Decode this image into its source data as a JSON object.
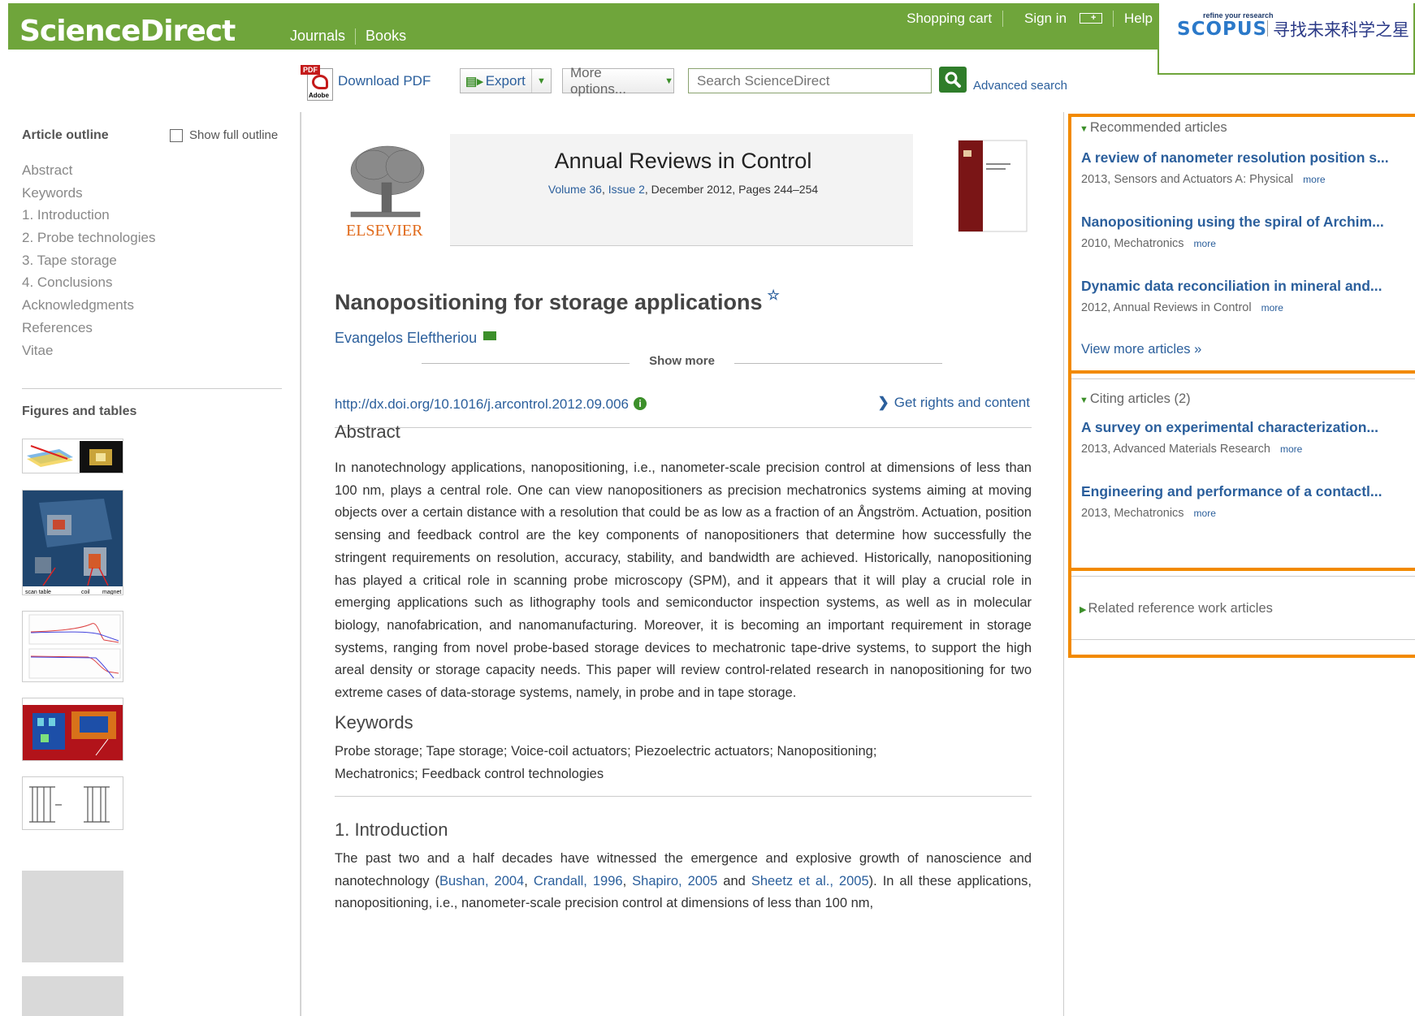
{
  "header": {
    "logo": "ScienceDirect",
    "nav": [
      "Journals",
      "Books"
    ],
    "user_nav": {
      "cart": "Shopping cart",
      "signin": "Sign in",
      "help": "Help"
    },
    "scopus": {
      "tagline": "refine your research",
      "name": "SCOPUS",
      "cn_slogan": "寻找未来科学之星"
    }
  },
  "toolbar": {
    "download_pdf": "Download PDF",
    "export": "Export",
    "more_options": "More options...",
    "search_placeholder": "Search ScienceDirect",
    "advanced_search": "Advanced search"
  },
  "outline": {
    "heading": "Article outline",
    "show_full": "Show full outline",
    "items": [
      "Abstract",
      "Keywords",
      "1. Introduction",
      "2. Probe technologies",
      "3. Tape storage",
      "4. Conclusions",
      "Acknowledgments",
      "References",
      "Vitae"
    ],
    "figures_heading": "Figures and tables",
    "figure_labels": {
      "scan_table": "scan table",
      "coil": "coil",
      "magnet": "magnet"
    }
  },
  "journal": {
    "publisher": "ELSEVIER",
    "title": "Annual Reviews in Control",
    "volume": "Volume 36",
    "issue": "Issue 2",
    "date_pages": ", December 2012, Pages 244–254"
  },
  "article": {
    "title": "Nanopositioning for storage applications",
    "star": "☆",
    "author": "Evangelos Eleftheriou",
    "show_more": "Show more",
    "doi": "http://dx.doi.org/10.1016/j.arcontrol.2012.09.006",
    "rights": "Get rights and content",
    "abstract_heading": "Abstract",
    "abstract": "In nanotechnology applications, nanopositioning, i.e., nanometer-scale precision control at dimensions of less than 100 nm, plays a central role. One can view nanopositioners as precision mechatronics systems aiming at moving objects over a certain distance with a resolution that could be as low as a fraction of an Ångström. Actuation, position sensing and feedback control are the key components of nanopositioners that determine how successfully the stringent requirements on resolution, accuracy, stability, and bandwidth are achieved. Historically, nanopositioning has played a critical role in scanning probe microscopy (SPM), and it appears that it will play a crucial role in emerging applications such as lithography tools and semiconductor inspection systems, as well as in molecular biology, nanofabrication, and nanomanufacturing. Moreover, it is becoming an important requirement in storage systems, ranging from novel probe-based storage devices to mechatronic tape-drive systems, to support the high areal density or storage capacity needs. This paper will review control-related research in nanopositioning for two extreme cases of data-storage systems, namely, in probe and in tape storage.",
    "keywords_heading": "Keywords",
    "keywords": "Probe storage; Tape storage; Voice-coil actuators; Piezoelectric actuators; Nanopositioning; Mechatronics; Feedback control technologies",
    "intro_heading": "1. Introduction",
    "intro": {
      "t1": "The past two and a half decades have witnessed the emergence and explosive growth of nanoscience and nanotechnology (",
      "ref1": "Bushan, 2004",
      "c1": ", ",
      "ref2": "Crandall, 1996",
      "c2": ", ",
      "ref3": "Shapiro, 2005",
      "and": " and ",
      "ref4": "Sheetz et al., 2005",
      "t2": "). In all these applications, nanopositioning, i.e., nanometer-scale precision control at dimensions of less than 100 nm,"
    }
  },
  "sidebar": {
    "recommended": {
      "heading": "Recommended articles",
      "items": [
        {
          "title": "A review of nanometer resolution position s...",
          "meta": "2013, Sensors and Actuators A: Physical",
          "more": "more"
        },
        {
          "title": "Nanopositioning using the spiral of Archim...",
          "meta": "2010, Mechatronics",
          "more": "more"
        },
        {
          "title": "Dynamic data reconciliation in mineral and...",
          "meta": "2012, Annual Reviews in Control",
          "more": "more"
        }
      ],
      "view_more": "View more articles »"
    },
    "citing": {
      "heading": "Citing articles (2)",
      "items": [
        {
          "title": "A survey on experimental characterization...",
          "meta": "2013, Advanced Materials Research",
          "more": "more"
        },
        {
          "title": "Engineering and performance of a contactl...",
          "meta": "2013, Mechatronics",
          "more": "more"
        }
      ]
    },
    "related": {
      "heading": "Related reference work articles"
    }
  },
  "colors": {
    "brand_green": "#6fa53b",
    "highlight_orange": "#f28a00",
    "link_blue": "#2b5f9c"
  }
}
